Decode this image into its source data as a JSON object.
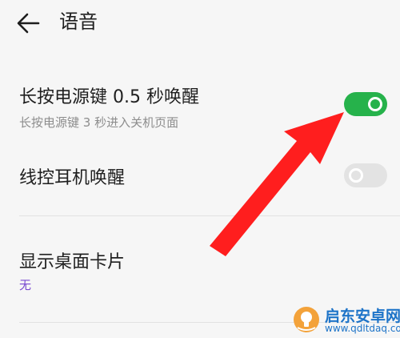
{
  "header": {
    "title": "语音",
    "back_icon": "arrow-left-icon"
  },
  "settings": [
    {
      "title": "长按电源键 0.5 秒唤醒",
      "subtitle": "长按电源键 3 秒进入关机页面",
      "toggle_state": "on"
    },
    {
      "title": "线控耳机唤醒",
      "toggle_state": "off"
    },
    {
      "title": "显示桌面卡片",
      "subtitle": "无"
    }
  ],
  "colors": {
    "background": "#f6f6f6",
    "toggle_on": "#26b24b",
    "toggle_off": "#e3e3e3",
    "annotation_arrow": "#ff1e1e",
    "value_text": "#7a4bd0",
    "watermark": "#1e74c8"
  },
  "watermark": {
    "name": "启东安卓网",
    "url": "www.qdltdaq.com",
    "logo_icon": "hand-bulb-logo-icon"
  }
}
